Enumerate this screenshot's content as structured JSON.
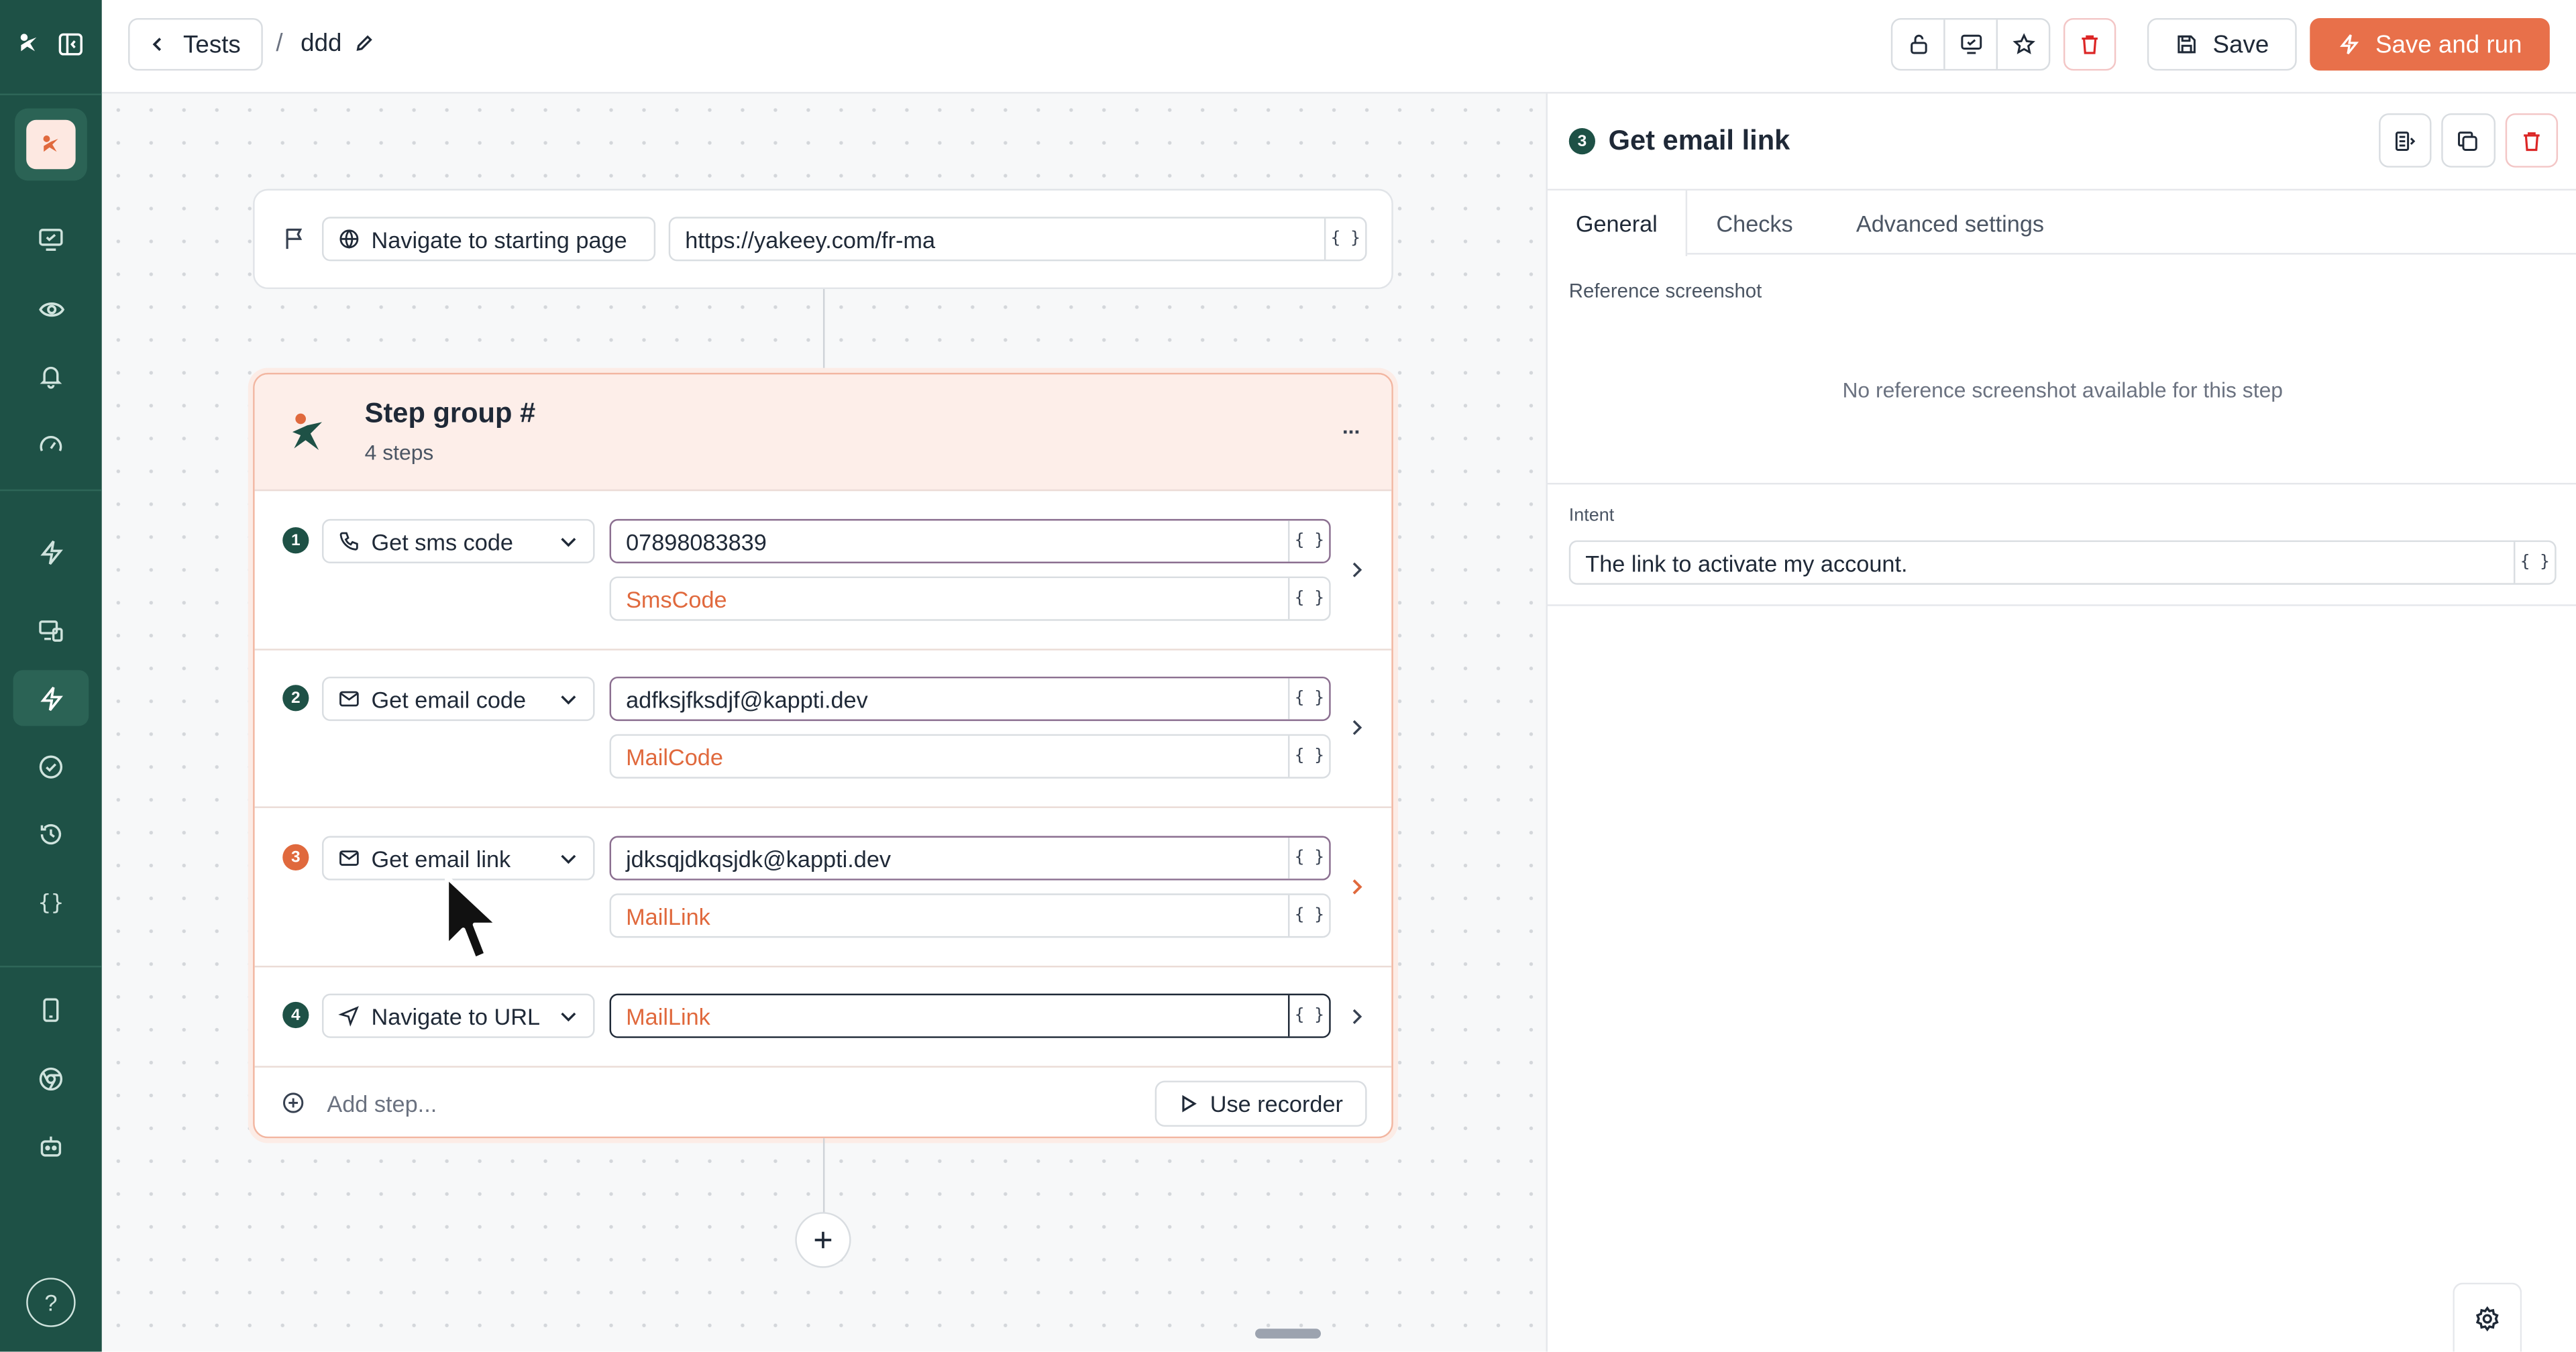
{
  "topbar": {
    "back_label": "Tests",
    "separator": "/",
    "test_name": "ddd",
    "save_label": "Save",
    "save_run_label": "Save and run"
  },
  "start": {
    "label": "Navigate to starting page",
    "url": "https://yakeey.com/fr-ma",
    "brace": "{ }"
  },
  "group": {
    "title": "Step group #",
    "subtitle": "4 steps",
    "more": "...",
    "steps": [
      {
        "num": "1",
        "action": "Get sms code",
        "value": "07898083839",
        "var": "SmsCode",
        "brace": "{ }"
      },
      {
        "num": "2",
        "action": "Get email code",
        "value": "adfksjfksdjf@kappti.dev",
        "var": "MailCode",
        "brace": "{ }"
      },
      {
        "num": "3",
        "action": "Get email link",
        "value": "jdksqjdkqsjdk@kappti.dev",
        "var": "MailLink",
        "brace": "{ }"
      },
      {
        "num": "4",
        "action": "Navigate to URL",
        "value": "MailLink",
        "brace": "{ }"
      }
    ],
    "add_step": "Add step...",
    "use_recorder": "Use recorder"
  },
  "panel": {
    "num": "3",
    "title": "Get email link",
    "tabs": [
      "General",
      "Checks",
      "Advanced settings"
    ],
    "ref_label": "Reference screenshot",
    "ref_empty": "No reference screenshot available for this step",
    "intent_label": "Intent",
    "intent_value": "The link to activate my account.",
    "brace": "{ }"
  },
  "sidebar": {
    "help": "?"
  },
  "colors": {
    "sidebar": "#1e5146",
    "accent": "#e0693d",
    "primary_button": "#e8704a",
    "group_bg": "#fdeee9",
    "step_num_green": "#1e5146",
    "step_num_orange": "#e0693d"
  }
}
